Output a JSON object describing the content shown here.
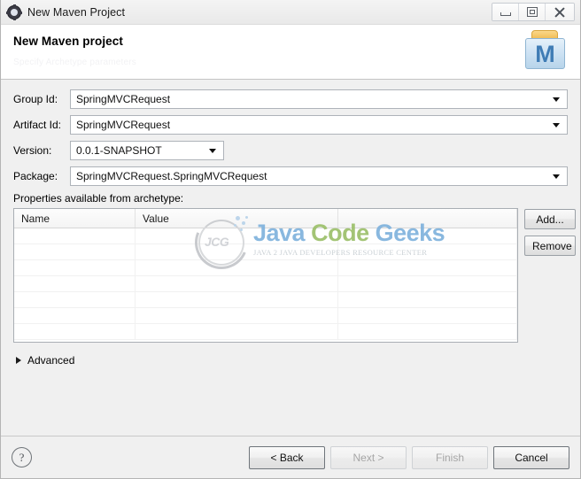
{
  "window": {
    "title": "New Maven Project",
    "app_icon": "eclipse-gear-icon",
    "controls": {
      "minimize": "minimize-icon",
      "maximize": "maximize-icon",
      "close": "close-icon"
    }
  },
  "banner": {
    "heading": "New Maven project",
    "subtitle": "Specify Archetype parameters",
    "icon": "maven-project-icon",
    "icon_letter": "M"
  },
  "form": {
    "rows": [
      {
        "label": "Group Id:",
        "value": "SpringMVCRequest",
        "type": "combo",
        "width": "full"
      },
      {
        "label": "Artifact Id:",
        "value": "SpringMVCRequest",
        "type": "combo",
        "width": "full"
      },
      {
        "label": "Version:",
        "value": "0.0.1-SNAPSHOT",
        "type": "combo",
        "width": "narrow"
      },
      {
        "label": "Package:",
        "value": "SpringMVCRequest.SpringMVCRequest",
        "type": "combo",
        "width": "full"
      }
    ]
  },
  "properties": {
    "label": "Properties available from archetype:",
    "columns": [
      "Name",
      "Value",
      ""
    ],
    "rows": [],
    "empty_row_count": 7,
    "buttons": {
      "add": "Add...",
      "remove": "Remove"
    }
  },
  "watermark": {
    "logo_text": "JCG",
    "word1": "Java",
    "word2": "Code",
    "word3": "Geeks",
    "tagline": "JAVA 2 JAVA DEVELOPERS RESOURCE CENTER",
    "color_blue": "#7fb2dd",
    "color_green": "#9cc06a"
  },
  "advanced": {
    "label": "Advanced",
    "expanded": false,
    "twistie_icon": "chevron-right-icon"
  },
  "footer": {
    "help_icon": "help-question-icon",
    "buttons": [
      {
        "label": "< Back",
        "enabled": true
      },
      {
        "label": "Next >",
        "enabled": false
      },
      {
        "label": "Finish",
        "enabled": false
      },
      {
        "label": "Cancel",
        "enabled": true
      }
    ]
  }
}
